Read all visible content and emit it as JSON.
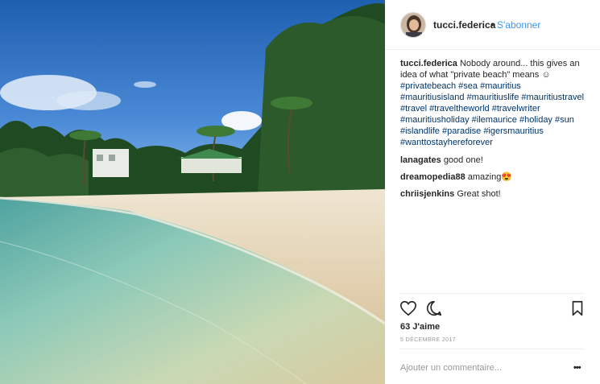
{
  "post": {
    "username": "tucci.federica",
    "separator": "•",
    "follow_label": "S'abonner",
    "caption": {
      "username": "tucci.federica",
      "text": "Nobody around... this gives an idea of what \"private beach\" means ☺",
      "hashtags": "#privatebeach #sea #mauritius #mauritiusisland #mauritiuslife #mauritiustravel #travel #traveltheworld #travelwriter #mauritiusholiday #ilemaurice #holiday #sun #islandlife #paradise #igersmauritius #wanttostayhereforever"
    },
    "comments": [
      {
        "username": "lanagates",
        "text": "good one!"
      },
      {
        "username": "dreamopedia88",
        "text": "amazing😍"
      },
      {
        "username": "chriisjenkins",
        "text": "Great shot!"
      }
    ],
    "likes_text": "63 J'aime",
    "date_text": "5 DÉCEMBRE 2017",
    "add_comment_placeholder": "Ajouter un commentaire...",
    "more_label": "•••"
  },
  "icons": {
    "like": "heart-outline-icon",
    "comment": "speech-bubble-icon",
    "save": "bookmark-icon",
    "more": "more-options-icon"
  },
  "colors": {
    "link_blue": "#3897f0",
    "hashtag_blue": "#003569",
    "text": "#262626",
    "muted": "#999999"
  }
}
